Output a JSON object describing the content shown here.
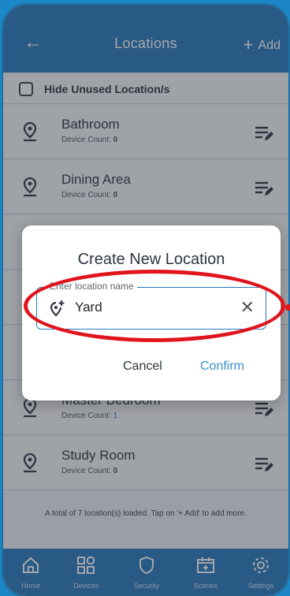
{
  "header": {
    "title": "Locations",
    "add_label": "Add"
  },
  "hide_unused": {
    "label": "Hide Unused Location/s",
    "checked": false
  },
  "locations": [
    {
      "name": "Bathroom",
      "count_label": "Device Count:",
      "count": "0"
    },
    {
      "name": "Dining Area",
      "count_label": "Device Count:",
      "count": "0"
    },
    {
      "name": "",
      "count_label": "",
      "count": ""
    },
    {
      "name": "",
      "count_label": "",
      "count": ""
    },
    {
      "name": "",
      "count_label": "",
      "count": ""
    },
    {
      "name": "Master Bedroom",
      "count_label": "Device Count:",
      "count": "1"
    },
    {
      "name": "Study Room",
      "count_label": "Device Count:",
      "count": "0"
    }
  ],
  "footer_text": "A total of 7 location(s) loaded. Tap on '+ Add' to add more.",
  "dialog": {
    "title": "Create New Location",
    "field_label": "Enter location name",
    "field_value": "Yard",
    "cancel": "Cancel",
    "confirm": "Confirm"
  },
  "nav": [
    {
      "label": "Home",
      "icon": "home-icon"
    },
    {
      "label": "Devices",
      "icon": "devices-icon"
    },
    {
      "label": "Security",
      "icon": "shield-icon"
    },
    {
      "label": "Scenes",
      "icon": "scenes-icon"
    },
    {
      "label": "Settings",
      "icon": "gear-icon"
    }
  ],
  "colors": {
    "accent": "#2a79bd",
    "annotation": "#e0141c"
  }
}
